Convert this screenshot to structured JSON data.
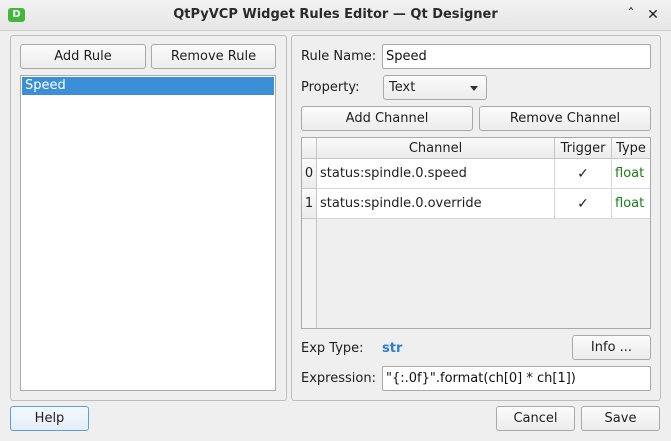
{
  "window": {
    "app_icon_letter": "D",
    "title": "QtPyVCP Widget Rules Editor — Qt Designer",
    "minimize_glyph": "ˆ",
    "close_glyph": "✕"
  },
  "rules_panel": {
    "add_rule_label": "Add Rule",
    "remove_rule_label": "Remove Rule",
    "rules": [
      {
        "label": "Speed",
        "selected": true
      }
    ]
  },
  "rule_editor": {
    "rule_name_label": "Rule Name:",
    "rule_name_value": "Speed",
    "property_label": "Property:",
    "property_value": "Text",
    "add_channel_label": "Add Channel",
    "remove_channel_label": "Remove Channel",
    "channel_table": {
      "headers": {
        "channel": "Channel",
        "trigger": "Trigger",
        "type": "Type"
      },
      "rows": [
        {
          "index": "0",
          "channel": "status:spindle.0.speed",
          "trigger": "✓",
          "type": "float"
        },
        {
          "index": "1",
          "channel": "status:spindle.0.override",
          "trigger": "✓",
          "type": "float"
        }
      ]
    },
    "exp_type_label": "Exp Type:",
    "exp_type_value": "str",
    "info_label": "Info ...",
    "expression_label": "Expression:",
    "expression_value": "\"{:.0f}\".format(ch[0] * ch[1])"
  },
  "footer": {
    "help_label": "Help",
    "cancel_label": "Cancel",
    "save_label": "Save"
  },
  "colors": {
    "selection": "#3a8fd6",
    "type_text": "#1a7d1a",
    "exp_type_text": "#2a7fd4",
    "app_icon": "#42b83a"
  }
}
